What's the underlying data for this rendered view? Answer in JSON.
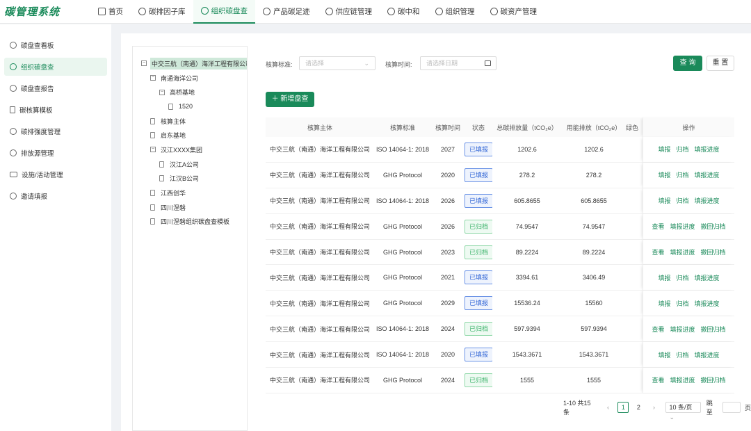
{
  "app": {
    "title": "碳管理系统"
  },
  "nav": [
    {
      "label": "首页",
      "icon": "home-icon"
    },
    {
      "label": "碳排因子库",
      "icon": "cloud-icon"
    },
    {
      "label": "组织碳盘查",
      "icon": "org-icon",
      "active": true
    },
    {
      "label": "产品碳足迹",
      "icon": "c-icon"
    },
    {
      "label": "供应链管理",
      "icon": "shield-icon"
    },
    {
      "label": "碳中和",
      "icon": "c-icon"
    },
    {
      "label": "组织管理",
      "icon": "user-icon"
    },
    {
      "label": "碳资产管理",
      "icon": "asset-icon"
    }
  ],
  "sidebar": [
    {
      "label": "碳盘查看板",
      "icon": "dashboard-icon"
    },
    {
      "label": "组织碳盘查",
      "icon": "org-icon",
      "active": true
    },
    {
      "label": "碳盘查报告",
      "icon": "report-icon"
    },
    {
      "label": "碳核算模板",
      "icon": "document-icon"
    },
    {
      "label": "碳排强度管理",
      "icon": "gauge-icon"
    },
    {
      "label": "排放源管理",
      "icon": "close-circle-icon"
    },
    {
      "label": "设施/活动管理",
      "icon": "device-icon"
    },
    {
      "label": "邀请填报",
      "icon": "invite-icon"
    }
  ],
  "tree": [
    {
      "label": "中交三航（南通）海洋工程有限公司",
      "level": 0,
      "type": "toggle",
      "selected": true
    },
    {
      "label": "南通海洋公司",
      "level": 1,
      "type": "toggle"
    },
    {
      "label": "高桥基地",
      "level": 2,
      "type": "toggle"
    },
    {
      "label": "1520",
      "level": 3,
      "type": "leaf"
    },
    {
      "label": "核算主体",
      "level": 1,
      "type": "leaf"
    },
    {
      "label": "启东基地",
      "level": 1,
      "type": "leaf"
    },
    {
      "label": "汉江XXXX集团",
      "level": 1,
      "type": "toggle"
    },
    {
      "label": "汉江A公司",
      "level": 2,
      "type": "leaf"
    },
    {
      "label": "江汉B公司",
      "level": 2,
      "type": "leaf"
    },
    {
      "label": "江西创华",
      "level": 1,
      "type": "leaf"
    },
    {
      "label": "四川涅磐",
      "level": 1,
      "type": "leaf"
    },
    {
      "label": "四川涅磐组织碳盘查模板",
      "level": 1,
      "type": "leaf"
    }
  ],
  "filters": {
    "standard_label": "核算标准:",
    "standard_placeholder": "请选择",
    "time_label": "核算时间:",
    "time_placeholder": "请选择日期",
    "query": "查 询",
    "reset": "重 置",
    "add": "新增盘查"
  },
  "table": {
    "headers": [
      "核算主体",
      "核算标准",
      "核算时间",
      "状态",
      "总碳排放量（tCO₂e）",
      "用能排放（tCO₂e）",
      "绿色",
      "操作"
    ],
    "rows": [
      {
        "entity": "中交三航（南通）海洋工程有限公司",
        "standard": "ISO 14064-1: 2018",
        "year": "2027",
        "status": "已填报",
        "total": "1202.6",
        "energy": "1202.6",
        "ops": [
          "填报",
          "归档",
          "填报进度"
        ]
      },
      {
        "entity": "中交三航（南通）海洋工程有限公司",
        "standard": "GHG Protocol",
        "year": "2020",
        "status": "已填报",
        "total": "278.2",
        "energy": "278.2",
        "ops": [
          "填报",
          "归档",
          "填报进度"
        ]
      },
      {
        "entity": "中交三航（南通）海洋工程有限公司",
        "standard": "ISO 14064-1: 2018",
        "year": "2026",
        "status": "已填报",
        "total": "605.8655",
        "energy": "605.8655",
        "ops": [
          "填报",
          "归档",
          "填报进度"
        ]
      },
      {
        "entity": "中交三航（南通）海洋工程有限公司",
        "standard": "GHG Protocol",
        "year": "2026",
        "status": "已归档",
        "total": "74.9547",
        "energy": "74.9547",
        "ops": [
          "查看",
          "填报进度",
          "撤回归档"
        ]
      },
      {
        "entity": "中交三航（南通）海洋工程有限公司",
        "standard": "GHG Protocol",
        "year": "2023",
        "status": "已归档",
        "total": "89.2224",
        "energy": "89.2224",
        "ops": [
          "查看",
          "填报进度",
          "撤回归档"
        ]
      },
      {
        "entity": "中交三航（南通）海洋工程有限公司",
        "standard": "GHG Protocol",
        "year": "2021",
        "status": "已填报",
        "total": "3394.61",
        "energy": "3406.49",
        "ops": [
          "填报",
          "归档",
          "填报进度"
        ]
      },
      {
        "entity": "中交三航（南通）海洋工程有限公司",
        "standard": "GHG Protocol",
        "year": "2029",
        "status": "已填报",
        "total": "15536.24",
        "energy": "15560",
        "ops": [
          "填报",
          "归档",
          "填报进度"
        ]
      },
      {
        "entity": "中交三航（南通）海洋工程有限公司",
        "standard": "ISO 14064-1: 2018",
        "year": "2024",
        "status": "已归档",
        "total": "597.9394",
        "energy": "597.9394",
        "ops": [
          "查看",
          "填报进度",
          "撤回归档"
        ]
      },
      {
        "entity": "中交三航（南通）海洋工程有限公司",
        "standard": "ISO 14064-1: 2018",
        "year": "2020",
        "status": "已填报",
        "total": "1543.3671",
        "energy": "1543.3671",
        "ops": [
          "填报",
          "归档",
          "填报进度"
        ]
      },
      {
        "entity": "中交三航（南通）海洋工程有限公司",
        "standard": "GHG Protocol",
        "year": "2024",
        "status": "已归档",
        "total": "1555",
        "energy": "1555",
        "ops": [
          "查看",
          "填报进度",
          "撤回归档"
        ]
      }
    ]
  },
  "pagination": {
    "summary": "1-10 共15条",
    "pages": [
      "1",
      "2"
    ],
    "current": "1",
    "page_size": "10 条/页",
    "jump_label": "跳至",
    "jump_suffix": "页"
  },
  "colors": {
    "primary": "#1a8a5a",
    "filed": "#3367d6",
    "archived": "#3bb36a"
  }
}
